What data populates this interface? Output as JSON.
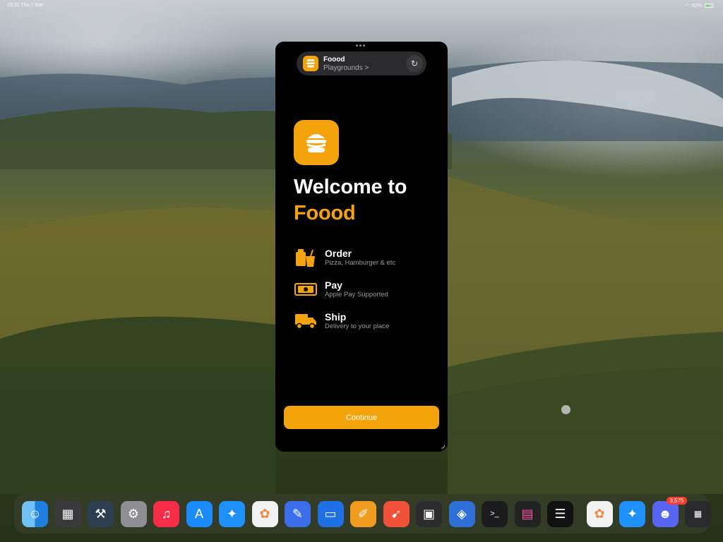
{
  "status_bar": {
    "time": "23:31 Thu 7 Mar",
    "battery": "62%"
  },
  "window": {
    "app_name": "Foood",
    "subtitle": "Playgrounds >",
    "welcome_line1": "Welcome to",
    "welcome_brand": "Foood",
    "features": [
      {
        "title": "Order",
        "subtitle": "Pizza, Hamburger & etc",
        "icon": "bag-cup-icon"
      },
      {
        "title": "Pay",
        "subtitle": "Apple Pay Supported",
        "icon": "banknote-icon"
      },
      {
        "title": "Ship",
        "subtitle": "Delivery to your place",
        "icon": "truck-icon"
      }
    ],
    "continue_label": "Continue",
    "accent_color": "#f5a30a"
  },
  "dock": {
    "apps": [
      {
        "name": "finder-icon"
      },
      {
        "name": "calculator-icon"
      },
      {
        "name": "xcode-icon"
      },
      {
        "name": "settings-icon"
      },
      {
        "name": "music-icon"
      },
      {
        "name": "app-store-icon"
      },
      {
        "name": "safari-icon"
      },
      {
        "name": "photos-icon"
      },
      {
        "name": "pencil-app-icon"
      },
      {
        "name": "keynote-icon"
      },
      {
        "name": "pages-icon"
      },
      {
        "name": "swift-playgrounds-icon"
      },
      {
        "name": "stage-manager-icon"
      },
      {
        "name": "shortcuts-icon"
      },
      {
        "name": "terminal-icon"
      },
      {
        "name": "color-app-icon"
      },
      {
        "name": "sidebar-app-icon"
      },
      {
        "name": "photos-recent-icon"
      },
      {
        "name": "safari-recent-icon"
      },
      {
        "name": "discord-icon"
      },
      {
        "name": "app-folder-icon"
      }
    ],
    "discord_badge": "3,575"
  }
}
